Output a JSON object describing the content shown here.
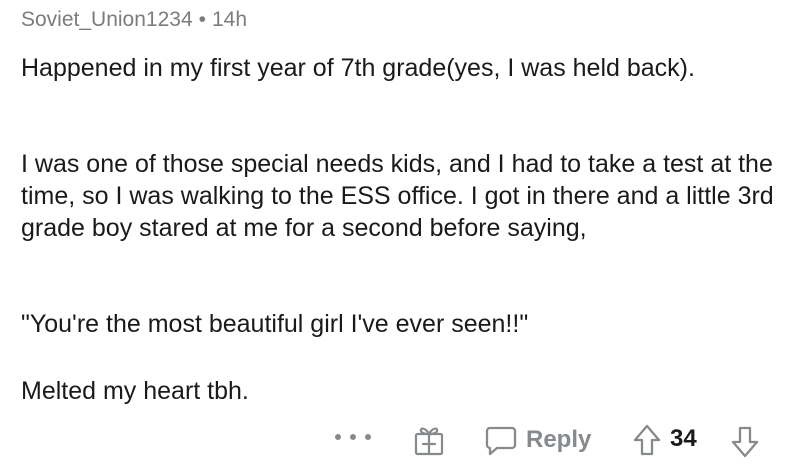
{
  "comment": {
    "author": "Soviet_Union1234",
    "separator": "•",
    "age": "14h",
    "paragraphs": [
      "Happened in my first year of 7th grade(yes, I was held back).",
      "I was one of those special needs kids, and I had to take a test at the time, so I was walking to the ESS office. I got in there and a little 3rd grade boy stared at me for a second before saying,",
      "\"You're the most beautiful girl I've ever seen!!\"",
      "Melted my heart tbh."
    ]
  },
  "actions": {
    "more_icon": "more-horizontal-icon",
    "award_icon": "gift-award-icon",
    "reply_icon": "speech-bubble-icon",
    "reply_label": "Reply",
    "upvote_icon": "arrow-up-icon",
    "score": "34",
    "downvote_icon": "arrow-down-icon"
  },
  "colors": {
    "text": "#1a1a1b",
    "meta": "#7c7c7c",
    "icon": "#878a8c",
    "background": "#ffffff"
  }
}
